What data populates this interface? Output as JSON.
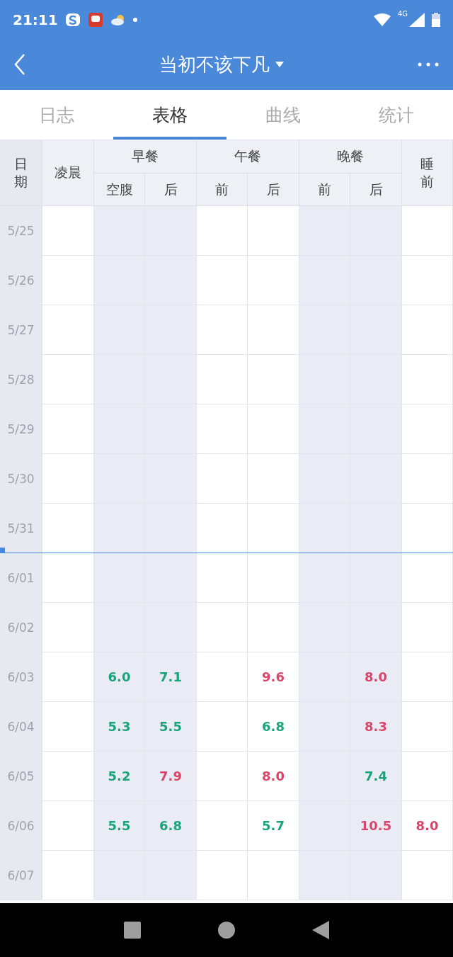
{
  "status_bar": {
    "time": "21:11",
    "network": "4G"
  },
  "header": {
    "title": "当初不该下凡"
  },
  "tabs": [
    {
      "label": "日志",
      "selected": false
    },
    {
      "label": "表格",
      "selected": true
    },
    {
      "label": "曲线",
      "selected": false
    },
    {
      "label": "统计",
      "selected": false
    }
  ],
  "table": {
    "columns": [
      {
        "label": "日期",
        "kind": "vertical"
      },
      {
        "label": "凌晨",
        "kind": "single"
      },
      {
        "label": "空腹",
        "kind": "sub",
        "group": "早餐"
      },
      {
        "label": "后",
        "kind": "sub"
      },
      {
        "label": "前",
        "kind": "sub",
        "group": "午餐"
      },
      {
        "label": "后",
        "kind": "sub"
      },
      {
        "label": "前",
        "kind": "sub",
        "group": "晚餐"
      },
      {
        "label": "后",
        "kind": "sub"
      },
      {
        "label": "睡前",
        "kind": "vertical"
      }
    ],
    "rows": [
      {
        "marker": false,
        "cells": [
          "5/25",
          "",
          "",
          "",
          "",
          "",
          "",
          "",
          ""
        ]
      },
      {
        "marker": false,
        "cells": [
          "5/26",
          "",
          "",
          "",
          "",
          "",
          "",
          "",
          ""
        ]
      },
      {
        "marker": false,
        "cells": [
          "5/27",
          "",
          "",
          "",
          "",
          "",
          "",
          "",
          ""
        ]
      },
      {
        "marker": false,
        "cells": [
          "5/28",
          "",
          "",
          "",
          "",
          "",
          "",
          "",
          ""
        ]
      },
      {
        "marker": false,
        "cells": [
          "5/29",
          "",
          "",
          "",
          "",
          "",
          "",
          "",
          ""
        ]
      },
      {
        "marker": false,
        "cells": [
          "5/30",
          "",
          "",
          "",
          "",
          "",
          "",
          "",
          ""
        ]
      },
      {
        "marker": true,
        "cells": [
          "5/31",
          "",
          "",
          "",
          "",
          "",
          "",
          "",
          ""
        ]
      },
      {
        "marker": false,
        "cells": [
          "6/01",
          "",
          "",
          "",
          "",
          "",
          "",
          "",
          ""
        ]
      },
      {
        "marker": false,
        "cells": [
          "6/02",
          "",
          "",
          "",
          "",
          "",
          "",
          "",
          ""
        ]
      },
      {
        "marker": false,
        "cells": [
          "6/03",
          "",
          {
            "value": "6.0",
            "color": "#1ba37c"
          },
          {
            "value": "7.1",
            "color": "#1ba37c"
          },
          "",
          {
            "value": "9.6",
            "color": "#d9466a"
          },
          "",
          {
            "value": "8.0",
            "color": "#d9466a"
          },
          ""
        ]
      },
      {
        "marker": false,
        "cells": [
          "6/04",
          "",
          {
            "value": "5.3",
            "color": "#1ba37c"
          },
          {
            "value": "5.5",
            "color": "#1ba37c"
          },
          "",
          {
            "value": "6.8",
            "color": "#1ba37c"
          },
          "",
          {
            "value": "8.3",
            "color": "#d9466a"
          },
          ""
        ]
      },
      {
        "marker": false,
        "cells": [
          "6/05",
          "",
          {
            "value": "5.2",
            "color": "#1ba37c"
          },
          {
            "value": "7.9",
            "color": "#d9466a"
          },
          "",
          {
            "value": "8.0",
            "color": "#d9466a"
          },
          "",
          {
            "value": "7.4",
            "color": "#1ba37c"
          },
          ""
        ]
      },
      {
        "marker": false,
        "cells": [
          "6/06",
          "",
          {
            "value": "5.5",
            "color": "#1ba37c"
          },
          {
            "value": "6.8",
            "color": "#1ba37c"
          },
          "",
          {
            "value": "5.7",
            "color": "#1ba37c"
          },
          "",
          {
            "value": "10.5",
            "color": "#d9466a"
          },
          {
            "value": "8.0",
            "color": "#d9466a"
          }
        ]
      },
      {
        "marker": false,
        "cells": [
          "6/07",
          "",
          "",
          "",
          "",
          "",
          "",
          "",
          ""
        ]
      }
    ]
  }
}
